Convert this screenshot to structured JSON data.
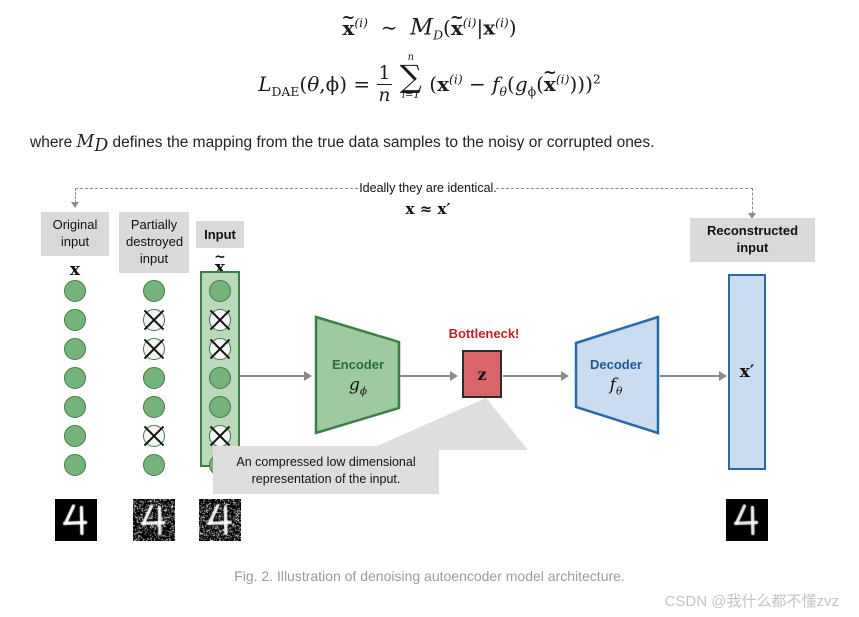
{
  "equations": {
    "line1_plain": "x̃(i) ~ M_D(x̃(i)|x(i))",
    "line2_plain": "L_DAE(θ,φ) = (1/n) Σ_{i=1}^{n} (x(i) − f_θ(g_φ(x̃(i))))²",
    "sum_upper": "n",
    "sum_lower": "i=1",
    "frac_num": "1",
    "frac_den": "n"
  },
  "where_text": {
    "before": "where ",
    "symbol": "M",
    "symbol_sub": "D",
    "after": " defines the mapping from the true data samples to the noisy or corrupted ones."
  },
  "figure": {
    "ideal_note": "Ideally they are identical.",
    "ideal_equation": "x ≈ x′",
    "labels": {
      "original_input": "Original\ninput",
      "original_input_line1": "Original",
      "original_input_line2": "input",
      "partially_destroyed_line1": "Partially",
      "partially_destroyed_line2": "destroyed",
      "partially_destroyed_line3": "input",
      "input": "Input",
      "reconstructed_line1": "Reconstructed",
      "reconstructed_line2": "input"
    },
    "symbols": {
      "x": "x",
      "x_tilde": "x̃",
      "x_prime": "x′",
      "z": "z"
    },
    "encoder": {
      "title": "Encoder",
      "func": "gφ",
      "color": "#76b37a",
      "stroke": "#3f7d46"
    },
    "decoder": {
      "title": "Decoder",
      "func": "fθ",
      "color": "#cadcf0",
      "stroke": "#2a69ac"
    },
    "bottleneck": {
      "label": "Bottleneck!",
      "value": "z",
      "color": "#d9656a",
      "label_color": "#c0202a"
    },
    "callout": {
      "line1": "An compressed low dimensional",
      "line2": "representation of the input."
    },
    "node_columns": [
      {
        "name": "original",
        "nodes": [
          "o",
          "o",
          "o",
          "o",
          "o",
          "o",
          "o"
        ]
      },
      {
        "name": "corrupted",
        "nodes": [
          "o",
          "x",
          "x",
          "o",
          "o",
          "x",
          "o"
        ]
      },
      {
        "name": "input",
        "nodes": [
          "o",
          "x",
          "x",
          "o",
          "o",
          "x",
          "o"
        ]
      }
    ]
  },
  "caption": "Fig. 2. Illustration of denoising autoencoder model architecture.",
  "watermark": "CSDN @我什么都不懂zvz"
}
